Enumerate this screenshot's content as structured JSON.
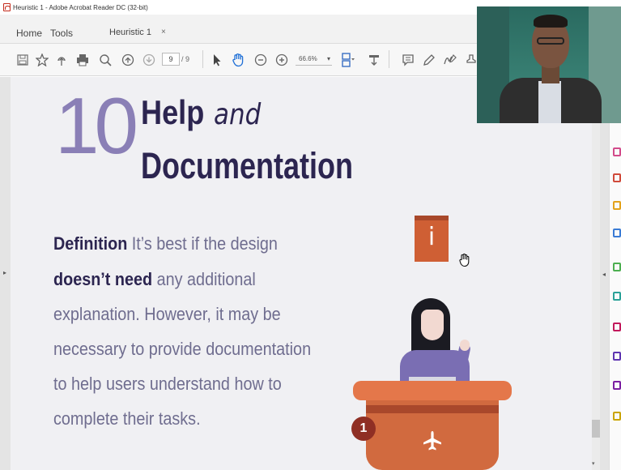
{
  "window": {
    "title": "Heuristic 1 - Adobe Acrobat Reader DC (32-bit)"
  },
  "menu": {
    "home": "Home",
    "tools": "Tools"
  },
  "tab": {
    "label": "Heuristic 1",
    "close": "×"
  },
  "toolbar": {
    "page_current": "9",
    "page_total": "/ 9",
    "zoom": "66.6%",
    "icons": [
      "save-icon",
      "bookmark-star-icon",
      "upload-icon",
      "print-icon",
      "zoom-search-icon",
      "page-up-icon",
      "page-down-icon",
      "select-arrow-icon",
      "hand-icon",
      "zoom-out-icon",
      "zoom-in-icon",
      "fit-page-icon",
      "scroll-mode-icon",
      "comment-icon",
      "highlight-pen-icon",
      "sign-icon",
      "stamp-icon"
    ]
  },
  "slide": {
    "number": "10",
    "title_help": "Help",
    "title_and": "and",
    "title_doc": "Documentation",
    "definition_label": "Definition",
    "line1_rest": " It’s best if the design",
    "line2_bold": "doesn’t need",
    "line2_rest": " any additional",
    "line3": "explanation. However, it may be",
    "line4": "necessary to provide documentation",
    "line5": "to help users understand how to",
    "line6": "complete their tasks.",
    "info_glyph": "i",
    "badge_number": "1"
  },
  "colors": {
    "accent_purple": "#8a7fb6",
    "title_navy": "#2c2550",
    "body_text": "#6f6d8f",
    "orange": "#cf5f34",
    "desk": "#e4774a"
  }
}
